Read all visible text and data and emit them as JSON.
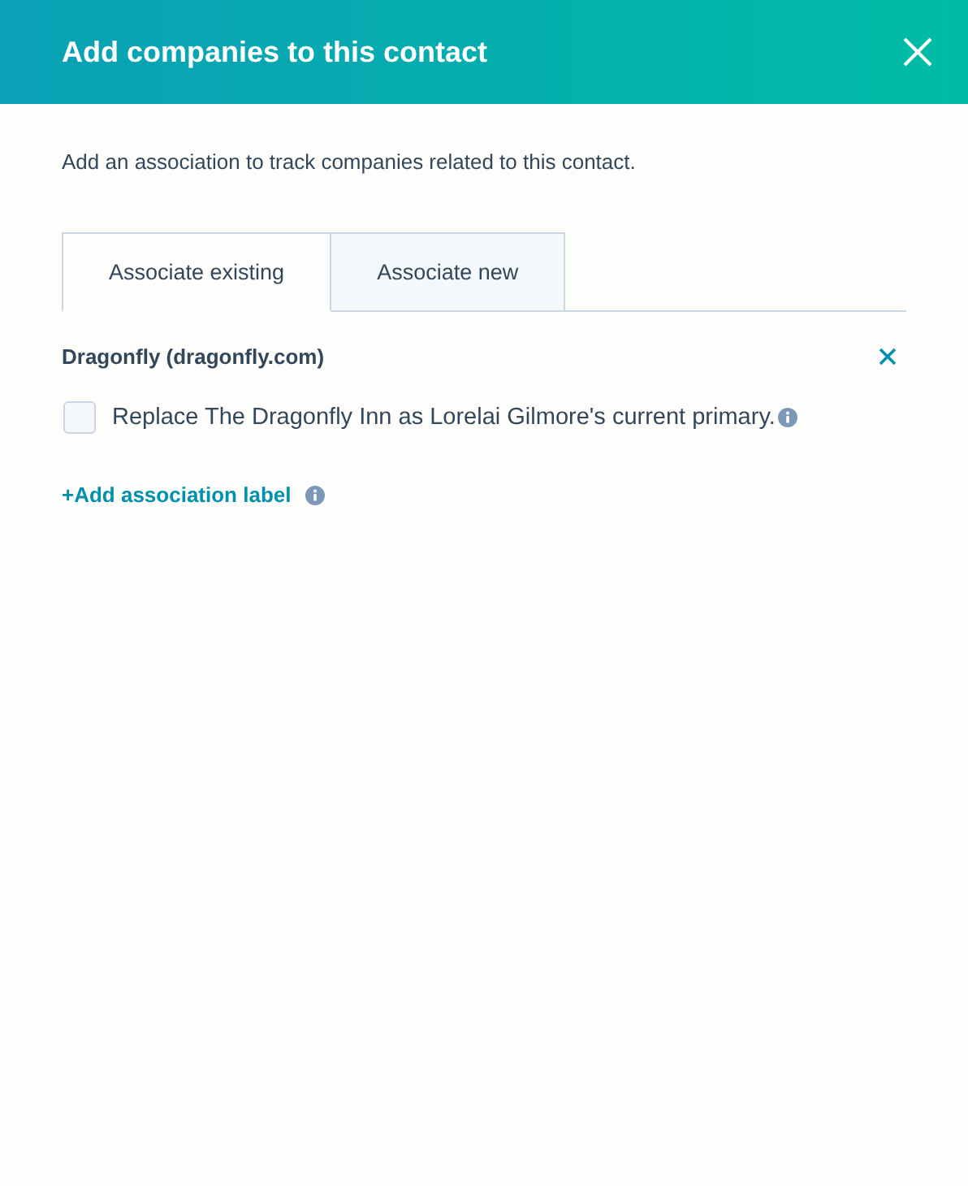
{
  "dialog": {
    "title": "Add companies to this contact",
    "description": "Add an association to track companies related to this contact."
  },
  "tabs": [
    {
      "label": "Associate existing",
      "selected": true
    },
    {
      "label": "Associate new",
      "selected": false
    }
  ],
  "association": {
    "company": "Dragonfly (dragonfly.com)",
    "option": {
      "label": "Replace The Dragonfly Inn as Lorelai Gilmore's current primary.",
      "checked": false
    },
    "add_label_link": "+Add association label"
  }
}
